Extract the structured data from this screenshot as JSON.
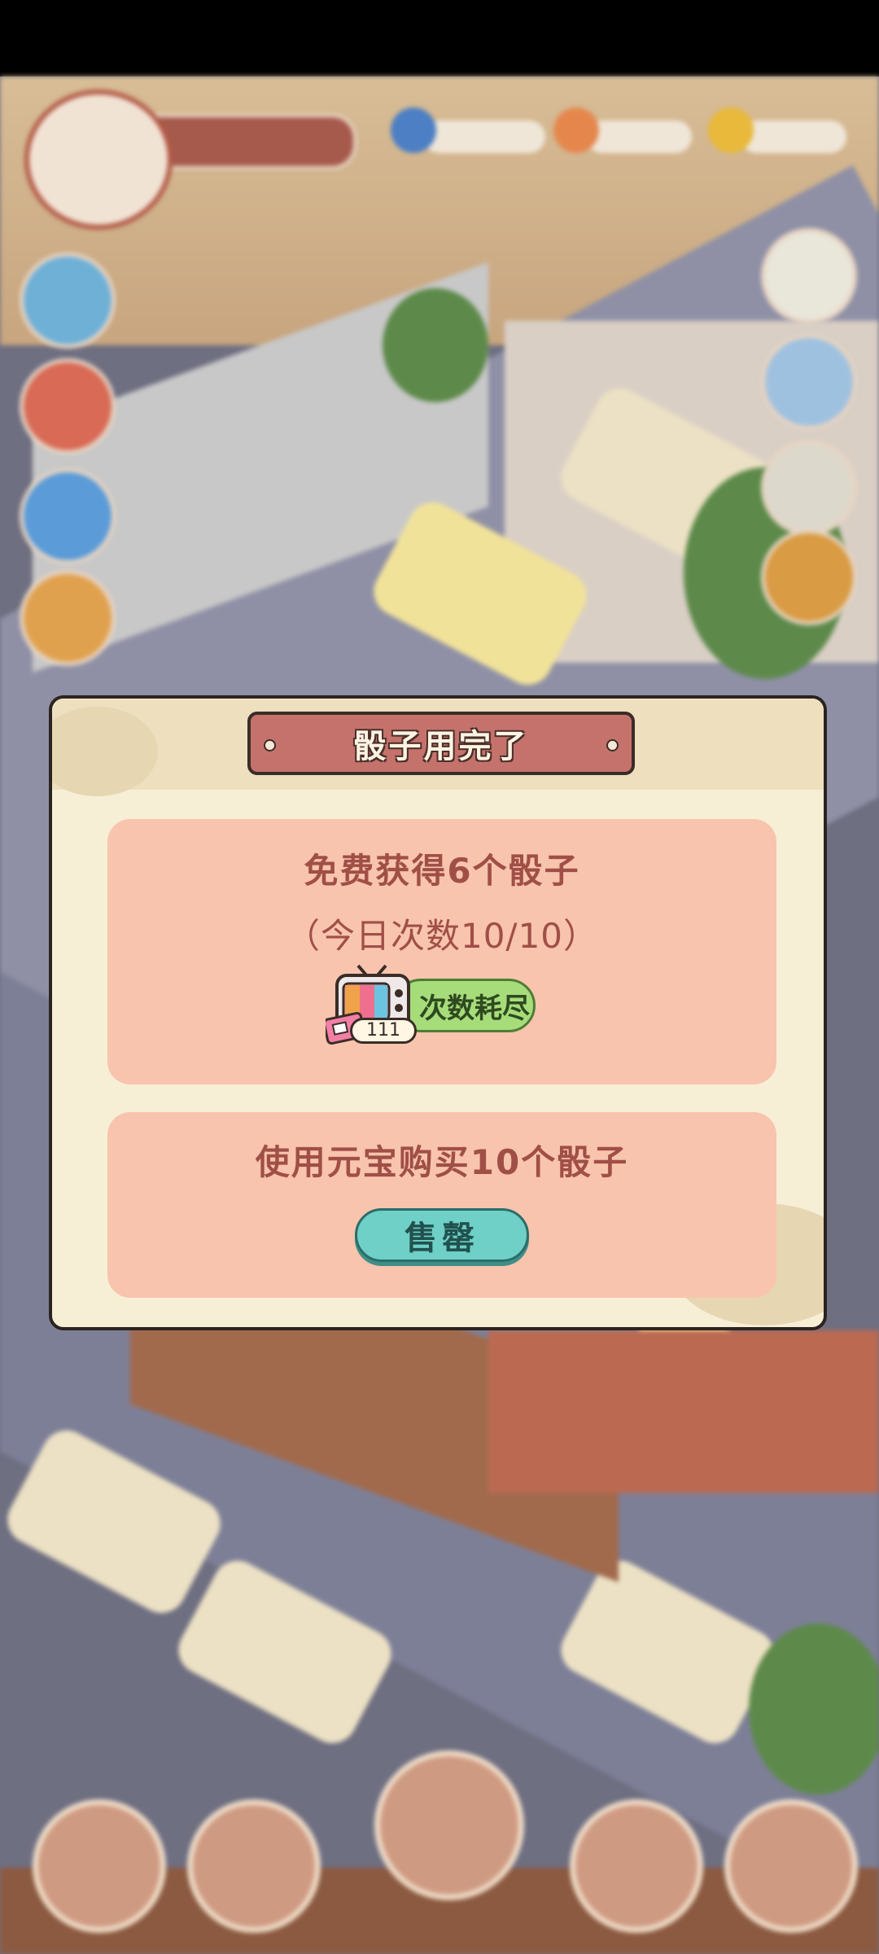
{
  "dialog": {
    "title": "骰子用完了",
    "free_offer": {
      "heading": "免费获得6个骰子",
      "daily_count": "（今日次数10/10）",
      "button_label": "次数耗尽",
      "ad_ticket_count": "111"
    },
    "buy_offer": {
      "heading": "使用元宝购买10个骰子",
      "button_label": "售罄"
    }
  },
  "colors": {
    "dialog_bg": "#f6efd6",
    "card_bg": "#f8c4ad",
    "title_plate": "#c6726c",
    "exhausted_button": "#a7dc7a",
    "sell_button": "#6ed0c7",
    "text_accent": "#a04f47"
  },
  "icons": {
    "ad": "tv-ad-icon"
  }
}
